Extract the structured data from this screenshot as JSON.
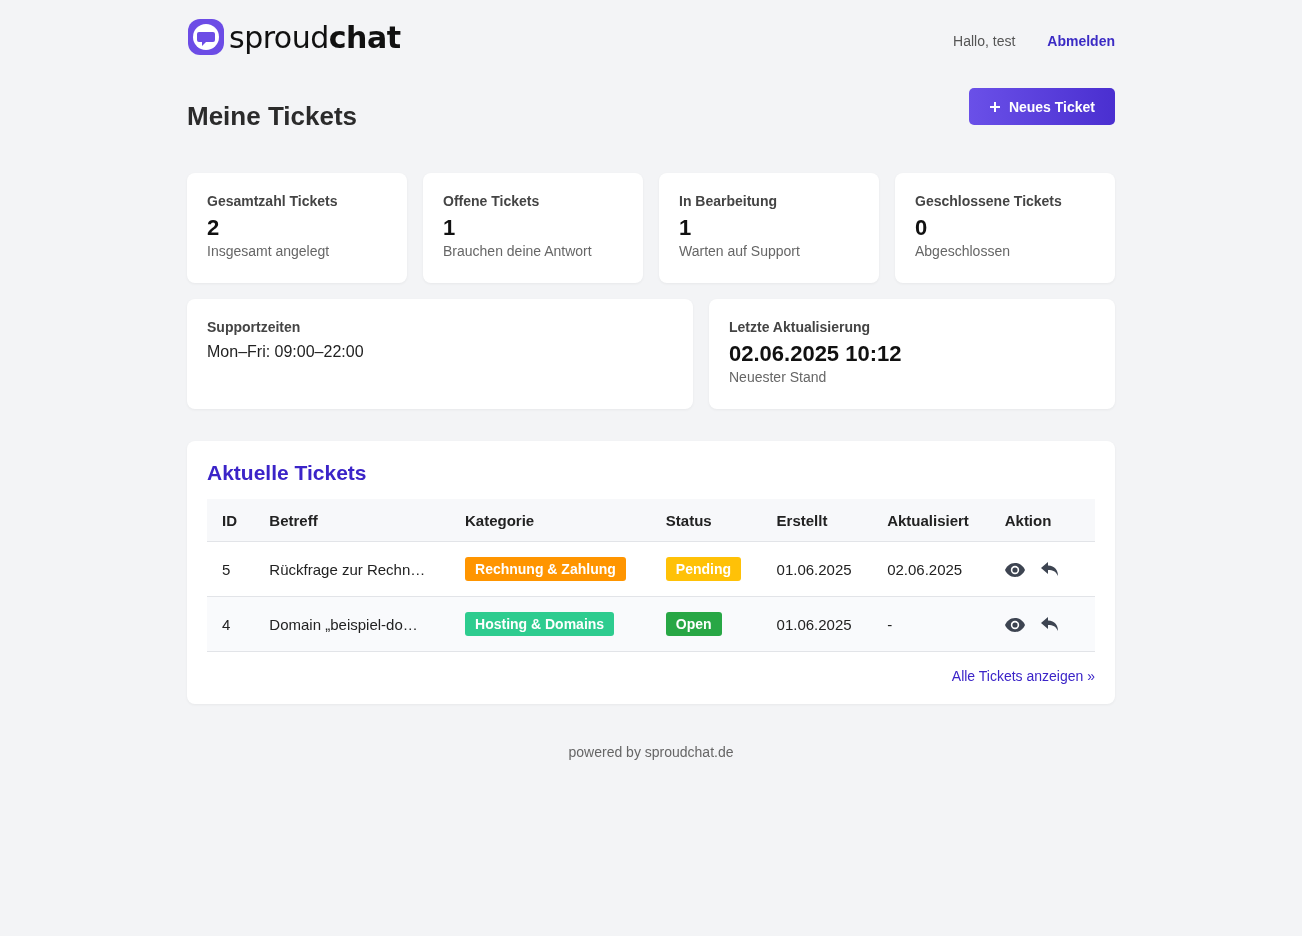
{
  "header": {
    "logo": "sproud**chat**",
    "greeting": "Hallo, test",
    "logout": "Abmelden"
  },
  "page_title": "Meine Tickets",
  "new_ticket_button": "Neues Ticket",
  "stats": [
    {
      "label": "Gesamtzahl Tickets",
      "value": "2",
      "note": "Insgesamt angelegt"
    },
    {
      "label": "Offene Tickets",
      "value": "1",
      "note": "Brauchen deine Antwort"
    },
    {
      "label": "In Bearbeitung",
      "value": "1",
      "note": "Warten auf Support"
    },
    {
      "label": "Geschlossene Tickets",
      "value": "0",
      "note": "Abgeschlossen"
    }
  ],
  "support_hours": {
    "label": "Supportzeiten",
    "value": "Mon–Fri: 09:00–22:00"
  },
  "last_update": {
    "label": "Letzte Aktualisierung",
    "value": "02.06.2025 10:12",
    "note": "Neuester Stand"
  },
  "tickets": {
    "title": "Aktuelle Tickets",
    "columns": [
      "ID",
      "Betreff",
      "Kategorie",
      "Status",
      "Erstellt",
      "Aktualisiert",
      "Aktion"
    ],
    "rows": [
      {
        "id": "5",
        "subject": "Rückfrage zur Rechn…",
        "category": {
          "label": "Rechnung & Zahlung",
          "color": "#ff9500"
        },
        "status": {
          "label": "Pending",
          "color": "#ffc107"
        },
        "created": "01.06.2025",
        "updated": "02.06.2025"
      },
      {
        "id": "4",
        "subject": "Domain „beispiel-do…",
        "category": {
          "label": "Hosting & Domains",
          "color": "#2ecc8f"
        },
        "status": {
          "label": "Open",
          "color": "#28a745"
        },
        "created": "01.06.2025",
        "updated": "-"
      }
    ],
    "all_link": "Alle Tickets anzeigen »"
  },
  "footer": "powered by sproudchat.de"
}
